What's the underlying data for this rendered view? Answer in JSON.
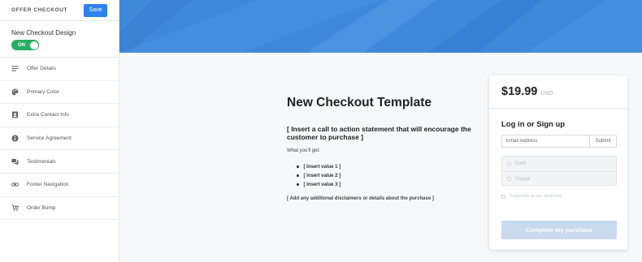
{
  "sidebar": {
    "title": "OFFER CHECKOUT",
    "save_label": "Save",
    "design": {
      "label": "New Checkout Design",
      "toggle": "ON"
    },
    "items": [
      {
        "label": "Offer Details",
        "icon": "lines-icon"
      },
      {
        "label": "Primary Color",
        "icon": "palette-icon"
      },
      {
        "label": "Extra Contact Info",
        "icon": "contact-card-icon"
      },
      {
        "label": "Service Agreement",
        "icon": "info-icon"
      },
      {
        "label": "Testimonials",
        "icon": "chat-bubbles-icon"
      },
      {
        "label": "Footer Navigation",
        "icon": "link-icon"
      },
      {
        "label": "Order Bump",
        "icon": "cart-icon"
      }
    ]
  },
  "content": {
    "title": "New Checkout Template",
    "cta": "[ Insert a call to action statement that will encourage the customer to purchase ]",
    "you_get": "What you'll get:",
    "values": [
      "[ Insert value 1 ]",
      "[ Insert value 2 ]",
      "[ Insert value 3 ]"
    ],
    "disclaimer": "[ Add any additional disclaimers or details about the purchase ]"
  },
  "card": {
    "price": "$19.99",
    "currency": "USD",
    "login_title": "Log in or Sign up",
    "email_placeholder": "Email Address",
    "submit_label": "Submit",
    "payment_options": [
      "Card",
      "Paypal"
    ],
    "subscribe_label": "Subscribe to our email list.",
    "complete_label": "Complete my purchase"
  },
  "colors": {
    "accent": "#2f80ed",
    "toggle_on": "#27ae60",
    "banner": "#3d86d8",
    "complete_disabled": "#c9d9ee"
  }
}
